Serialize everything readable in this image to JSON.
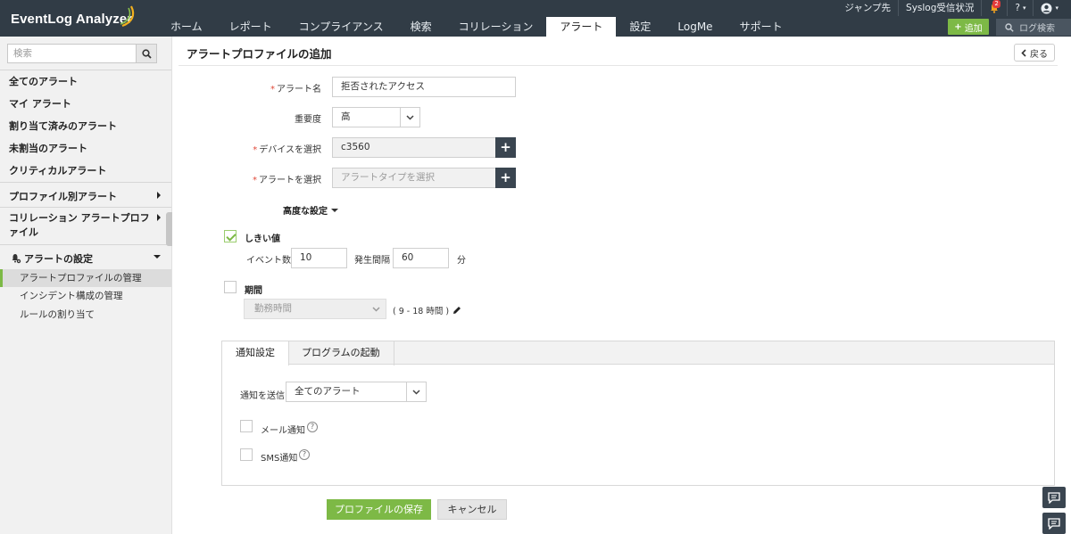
{
  "app": {
    "logo": "EventLog Analyzer"
  },
  "nav": {
    "tabs": [
      "ホーム",
      "レポート",
      "コンプライアンス",
      "検索",
      "コリレーション",
      "アラート",
      "設定",
      "LogMe",
      "サポート"
    ],
    "active_index": 5
  },
  "toplinks": {
    "jump": "ジャンプ先",
    "syslog": "Syslog受信状況",
    "notification_count": "2",
    "help": "?",
    "add_label": "追加",
    "log_search": "ログ検索"
  },
  "sidebar": {
    "search_placeholder": "検索",
    "items": [
      {
        "label": "全てのアラート"
      },
      {
        "label": "マイ アラート"
      },
      {
        "label": "割り当て済みのアラート"
      },
      {
        "label": "未割当のアラート"
      },
      {
        "label": "クリティカルアラート"
      },
      {
        "label": "プロファイル別アラート"
      },
      {
        "label": "コリレーション アラートプロファイル"
      },
      {
        "label": "アラートの設定"
      }
    ],
    "subitems": [
      {
        "label": "アラートプロファイルの管理"
      },
      {
        "label": "インシデント構成の管理"
      },
      {
        "label": "ルールの割り当て"
      }
    ]
  },
  "page": {
    "title": "アラートプロファイルの追加",
    "back_label": "戻る"
  },
  "form": {
    "alert_name_label": "アラート名",
    "alert_name_value": "拒否されたアクセス",
    "severity_label": "重要度",
    "severity_value": "高",
    "device_label": "デバイスを選択",
    "device_value": "c3560",
    "alert_select_label": "アラートを選択",
    "alert_select_placeholder": "アラートタイプを選択",
    "advanced_label": "高度な設定",
    "threshold_label": "しきい値",
    "event_count_label": "イベント数",
    "event_count_value": "10",
    "interval_label": "発生間隔",
    "interval_value": "60",
    "minutes_label": "分",
    "period_label": "期間",
    "period_value": "勤務時間",
    "period_hours": "( 9 - 18 時間 )"
  },
  "panel": {
    "tabs": [
      "通知設定",
      "プログラムの起動"
    ],
    "send_label": "通知を送信",
    "send_value": "全てのアラート",
    "email_label": "メール通知",
    "sms_label": "SMS通知"
  },
  "buttons": {
    "save": "プロファイルの保存",
    "cancel": "キャンセル"
  },
  "colors": {
    "header": "#313c46",
    "accent_green": "#7db946",
    "dark_button": "#3a4550",
    "required": "#e04a3a"
  }
}
